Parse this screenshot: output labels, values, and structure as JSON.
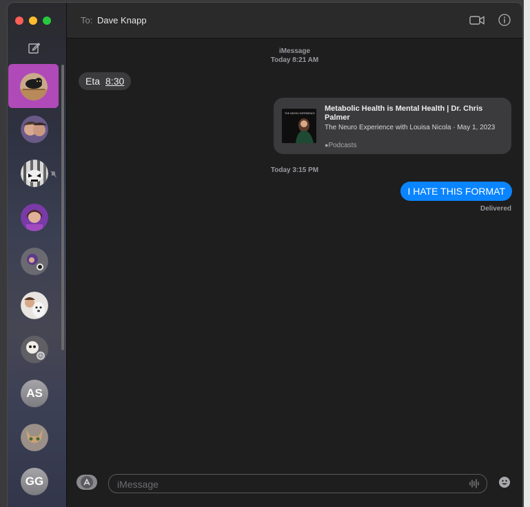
{
  "header": {
    "to_label": "To:",
    "recipient": "Dave Knapp"
  },
  "conversations": [
    {
      "kind": "photo",
      "selected": true
    },
    {
      "kind": "photo"
    },
    {
      "kind": "photo",
      "muted": true
    },
    {
      "kind": "photo"
    },
    {
      "kind": "photo"
    },
    {
      "kind": "photo"
    },
    {
      "kind": "photo"
    },
    {
      "kind": "initials",
      "initials": "AS"
    },
    {
      "kind": "photo"
    },
    {
      "kind": "initials",
      "initials": "GG"
    }
  ],
  "thread": {
    "service": "iMessage",
    "first_timestamp": "Today 8:21 AM",
    "incoming_text_1": "Eta",
    "incoming_text_2": "8:30",
    "link_card": {
      "title": "Metabolic Health is Mental Health | Dr. Chris Palmer",
      "subtitle": "The Neuro Experience with Louisa Nicola · May 1, 2023",
      "source": "Podcasts",
      "thumb_text": "THE NEURO EXPERIENCE"
    },
    "second_timestamp": "Today 3:15 PM",
    "outgoing_text": "I HATE THIS FORMAT",
    "status": "Delivered"
  },
  "composer": {
    "placeholder": "iMessage"
  },
  "colors": {
    "accent_blue": "#0a84ff",
    "selected_row": "#b04ab8"
  }
}
